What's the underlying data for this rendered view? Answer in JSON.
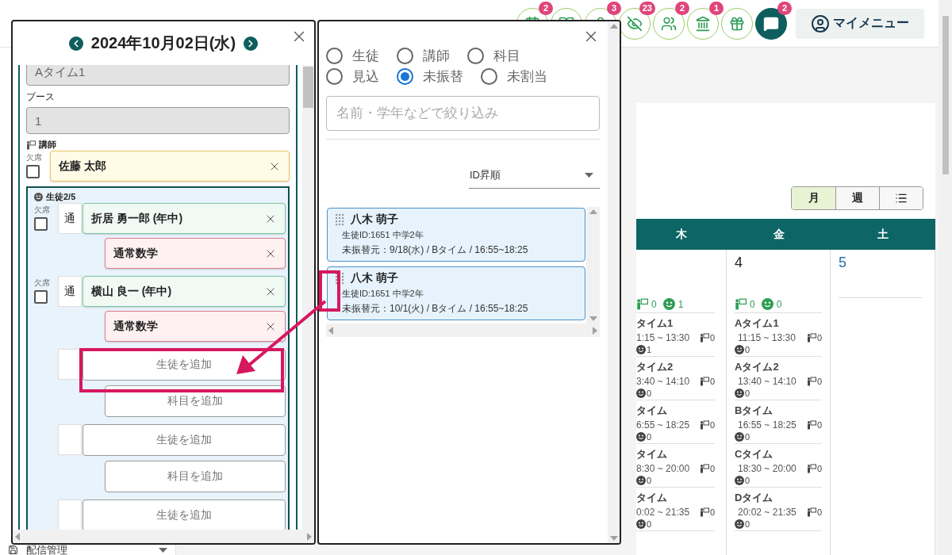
{
  "top_bar": {
    "icon_buttons": [
      {
        "kind": "calendar",
        "badge": "2"
      },
      {
        "kind": "book"
      },
      {
        "kind": "person",
        "badge": "3"
      },
      {
        "kind": "eye-off",
        "badge": "23"
      },
      {
        "kind": "group",
        "badge": "2"
      },
      {
        "kind": "school",
        "badge": "1"
      },
      {
        "kind": "gift"
      },
      {
        "kind": "chat",
        "badge": "2"
      }
    ],
    "my_menu": "マイメニュー"
  },
  "sidebar": {
    "items": [
      {
        "label": "配信管理"
      }
    ]
  },
  "calendar": {
    "views": [
      {
        "kind": "text",
        "label": "月",
        "selected": true
      },
      {
        "kind": "text",
        "label": "週",
        "selected": false
      },
      {
        "kind": "list",
        "selected": false
      }
    ],
    "weekdays": [
      "木",
      "金",
      "土"
    ],
    "days": [
      {
        "teacher_count": "0",
        "student_count": "1",
        "slots": [
          {
            "name": "タイム1",
            "time": "1:15 ~ 13:30",
            "teachers": "0",
            "students": "1"
          },
          {
            "name": "タイム2",
            "time": "3:40 ~ 14:10",
            "teachers": "0",
            "students": "0"
          },
          {
            "name": "タイム",
            "time": "6:55 ~ 18:25",
            "teachers": "0",
            "students": "0"
          },
          {
            "name": "タイム",
            "time": "8:30 ~ 20:00",
            "teachers": "0",
            "students": "0"
          },
          {
            "name": "タイム",
            "time": "0:02 ~ 21:35",
            "teachers": "0",
            "students": "0"
          }
        ]
      },
      {
        "number": "4",
        "teacher_count": "0",
        "student_count": "0",
        "slots": [
          {
            "name": "Aタイム1",
            "time": "11:15 ~ 13:30",
            "teachers": "0",
            "students": "0"
          },
          {
            "name": "Aタイム2",
            "time": "13:40 ~ 14:10",
            "teachers": "0",
            "students": "0"
          },
          {
            "name": "Bタイム",
            "time": "16:55 ~ 18:25",
            "teachers": "0",
            "students": "0"
          },
          {
            "name": "Cタイム",
            "time": "18:30 ~ 20:00",
            "teachers": "0",
            "students": "0"
          },
          {
            "name": "Dタイム",
            "time": "20:02 ~ 21:35",
            "teachers": "0",
            "students": "0"
          }
        ]
      },
      {
        "number": "5",
        "weekend": true
      }
    ]
  },
  "lesson_dialog": {
    "date": "2024年10月02日(水)",
    "time_slot": "Aタイム1",
    "booth_label": "ブース",
    "booth": "1",
    "teacher_label": "講師",
    "teacher": {
      "absent_label": "欠席",
      "absent": false,
      "name": "佐藤 太郎"
    },
    "students_label": "生徒2/5",
    "students": [
      {
        "absent_label": "欠席",
        "absent": false,
        "type": "通",
        "name": "折居 勇一郎 (年中)",
        "subject": "通常数学"
      },
      {
        "absent_label": "欠席",
        "absent": false,
        "type": "通",
        "name": "横山 良一 (年中)",
        "subject": "通常数学"
      }
    ],
    "empty_slots": [
      {
        "add_student": "生徒を追加",
        "add_subject": "科目を追加"
      },
      {
        "add_student": "生徒を追加",
        "add_subject": "科目を追加"
      },
      {
        "add_student": "生徒を追加"
      }
    ]
  },
  "filter_dialog": {
    "modes": [
      {
        "label": "生徒",
        "selected": false
      },
      {
        "label": "講師",
        "selected": false
      },
      {
        "label": "科目",
        "selected": false
      },
      {
        "label": "見込",
        "selected": false
      },
      {
        "label": "未振替",
        "selected": true
      },
      {
        "label": "未割当",
        "selected": false
      }
    ],
    "search": {
      "placeholder": "名前・学年などで絞り込み"
    },
    "sort": "ID昇順",
    "results": [
      {
        "name": "八木 萌子",
        "info": "生徒ID:1651 中学2年",
        "origin": "未振替元：9/18(水) / Bタイム / 16:55~18:25"
      },
      {
        "name": "八木 萌子",
        "info": "生徒ID:1651 中学2年",
        "origin": "未振替元：10/1(火) / Bタイム / 16:55~18:25"
      }
    ]
  }
}
